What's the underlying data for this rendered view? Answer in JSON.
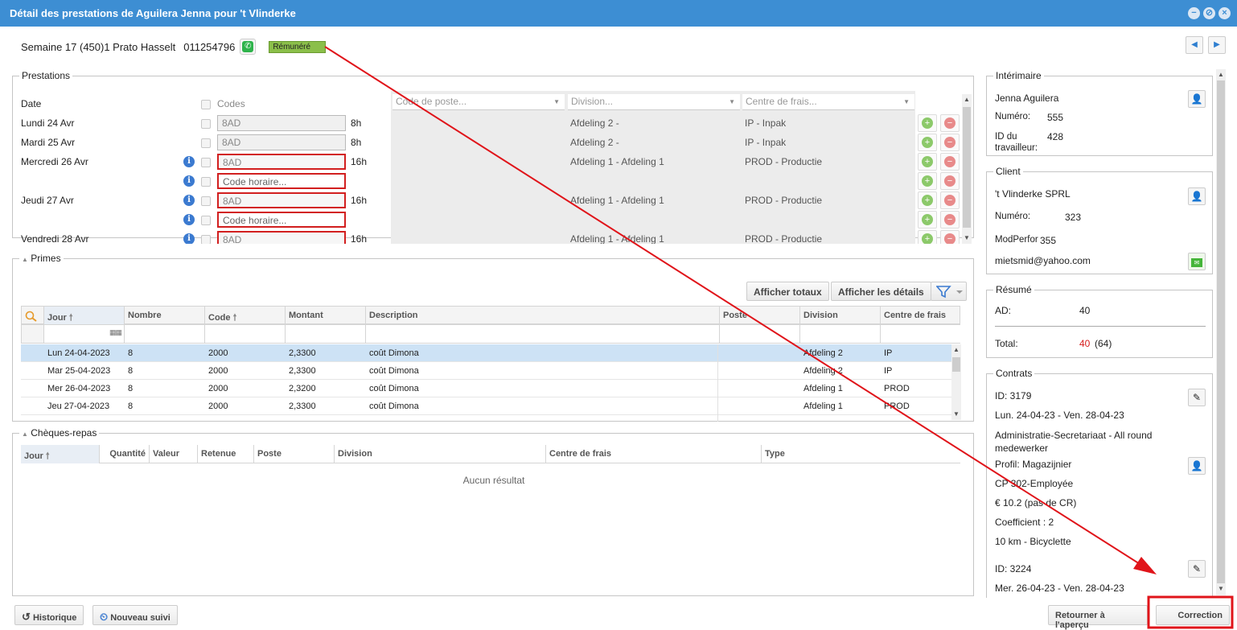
{
  "window": {
    "title": "Détail des prestations de Aguilera Jenna pour 't Vlinderke"
  },
  "header": {
    "week": "Semaine 17 (450)1 Prato Hasselt",
    "phone": "011254796",
    "status": "Rémunéré"
  },
  "prestations": {
    "legend": "Prestations",
    "date_header": "Date",
    "codes_header": "Codes",
    "combos": {
      "poste": "Code de poste...",
      "division": "Division...",
      "centre": "Centre de frais..."
    },
    "rows": [
      {
        "date": "Lundi 24 Avr",
        "code": "8AD",
        "hours": "8h",
        "division": "Afdeling 2 -",
        "centre": "IP - Inpak"
      },
      {
        "date": "Mardi 25 Avr",
        "code": "8AD",
        "hours": "8h",
        "division": "Afdeling 2 -",
        "centre": "IP - Inpak"
      },
      {
        "date": "Mercredi 26 Avr",
        "code": "8AD",
        "hours": "16h",
        "division": "Afdeling 1 - Afdeling 1",
        "centre": "PROD - Productie"
      },
      {
        "date": "",
        "code": "Code horaire...",
        "hours": "",
        "division": "",
        "centre": ""
      },
      {
        "date": "Jeudi 27 Avr",
        "code": "8AD",
        "hours": "16h",
        "division": "Afdeling 1 - Afdeling 1",
        "centre": "PROD - Productie"
      },
      {
        "date": "",
        "code": "Code horaire...",
        "hours": "",
        "division": "",
        "centre": ""
      },
      {
        "date": "Vendredi 28 Avr",
        "code": "8AD",
        "hours": "16h",
        "division": "Afdeling 1 - Afdeling 1",
        "centre": "PROD - Productie"
      }
    ]
  },
  "primes": {
    "legend": "Primes",
    "btn_totaux": "Afficher totaux",
    "btn_details": "Afficher les détails",
    "columns": [
      "Jour",
      "Nombre",
      "Code",
      "Montant",
      "Description",
      "Poste",
      "Division",
      "Centre de frais"
    ],
    "rows": [
      [
        "Lun 24-04-2023",
        "8",
        "2000",
        "2,3300",
        "coût Dimona",
        "",
        "Afdeling 2",
        "IP"
      ],
      [
        "Mar 25-04-2023",
        "8",
        "2000",
        "2,3300",
        "coût Dimona",
        "",
        "Afdeling 2",
        "IP"
      ],
      [
        "Mer 26-04-2023",
        "8",
        "2000",
        "2,3200",
        "coût Dimona",
        "",
        "Afdeling 1",
        "PROD"
      ],
      [
        "Jeu 27-04-2023",
        "8",
        "2000",
        "2,3300",
        "coût Dimona",
        "",
        "Afdeling 1",
        "PROD"
      ]
    ]
  },
  "cheques": {
    "legend": "Chèques-repas",
    "columns": [
      "Jour",
      "Quantité",
      "Valeur",
      "Retenue",
      "Poste",
      "Division",
      "Centre de frais",
      "Type"
    ],
    "empty": "Aucun résultat"
  },
  "interimaire": {
    "legend": "Intérimaire",
    "name": "Jenna Aguilera",
    "numero_label": "Numéro:",
    "numero": "555",
    "id_label": "ID du travailleur:",
    "id": "428"
  },
  "client": {
    "legend": "Client",
    "name": "'t Vlinderke SPRL",
    "numero_label": "Numéro:",
    "numero": "323",
    "modperfor_label": "ModPerfor",
    "modperfor": "355",
    "email": "mietsmid@yahoo.com"
  },
  "resume": {
    "legend": "Résumé",
    "ad_label": "AD:",
    "ad": "40",
    "total_label": "Total:",
    "total": "40",
    "total_extra": "(64)"
  },
  "contrats": {
    "legend": "Contrats",
    "c1_id": "ID: 3179",
    "c1_dates": "Lun. 24-04-23 - Ven. 28-04-23",
    "c1_function": "Administratie-Secretariaat - All round medewerker",
    "c1_profil": "Profil: Magazijnier",
    "c1_cp": "CP 302-Employée",
    "c1_wage": "€ 10.2 (pas de CR)",
    "c1_coef": "Coefficient : 2",
    "c1_transport": "10 km - Bicyclette",
    "c2_id": "ID: 3224",
    "c2_dates": "Mer. 26-04-23 - Ven. 28-04-23"
  },
  "footer": {
    "historique": "Historique",
    "nouveau_suivi": "Nouveau suivi",
    "retour": "Retourner à l'aperçu",
    "correction": "Correction"
  },
  "colors": {
    "accent": "#3d8ed3",
    "annotation": "#e0141a",
    "status_green": "#8bbf4a"
  }
}
